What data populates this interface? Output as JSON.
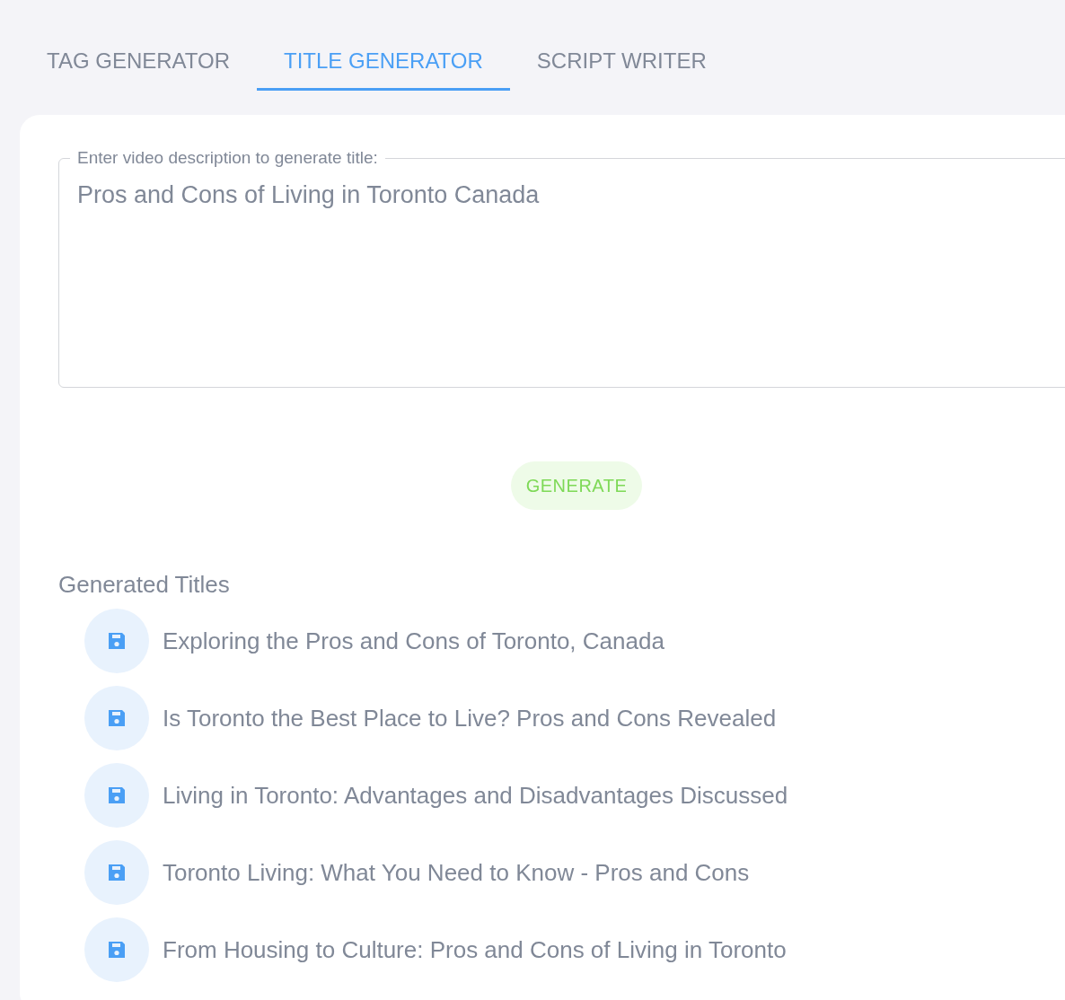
{
  "tabs": [
    {
      "label": "TAG GENERATOR",
      "selected": false
    },
    {
      "label": "TITLE GENERATOR",
      "selected": true
    },
    {
      "label": "SCRIPT WRITER",
      "selected": false
    }
  ],
  "description_field": {
    "label": "Enter video description to generate title:",
    "value": "Pros and Cons of Living in Toronto Canada"
  },
  "generate_button": "GENERATE",
  "results": {
    "heading": "Generated Titles",
    "titles": [
      "Exploring the Pros and Cons of Toronto, Canada",
      "Is Toronto the Best Place to Live? Pros and Cons Revealed",
      "Living in Toronto: Advantages and Disadvantages Discussed",
      "Toronto Living: What You Need to Know - Pros and Cons",
      "From Housing to Culture: Pros and Cons of Living in Toronto"
    ]
  }
}
